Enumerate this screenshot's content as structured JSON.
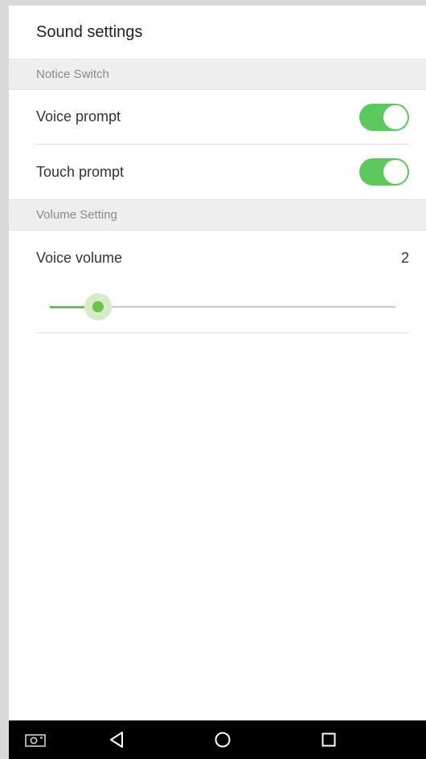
{
  "header": {
    "title": "Sound settings"
  },
  "sections": {
    "notice": {
      "label": "Notice Switch"
    },
    "volume": {
      "label": "Volume Setting"
    }
  },
  "notice_items": [
    {
      "label": "Voice prompt",
      "enabled": true
    },
    {
      "label": "Touch prompt",
      "enabled": true
    }
  ],
  "volume_item": {
    "label": "Voice volume",
    "value": "2",
    "slider_fraction": 0.14
  },
  "colors": {
    "accent": "#5cc95c",
    "slider": "#6cc24a"
  },
  "navbar": {
    "icons": [
      "screenshot-icon",
      "back-icon",
      "home-icon",
      "recents-icon"
    ]
  }
}
